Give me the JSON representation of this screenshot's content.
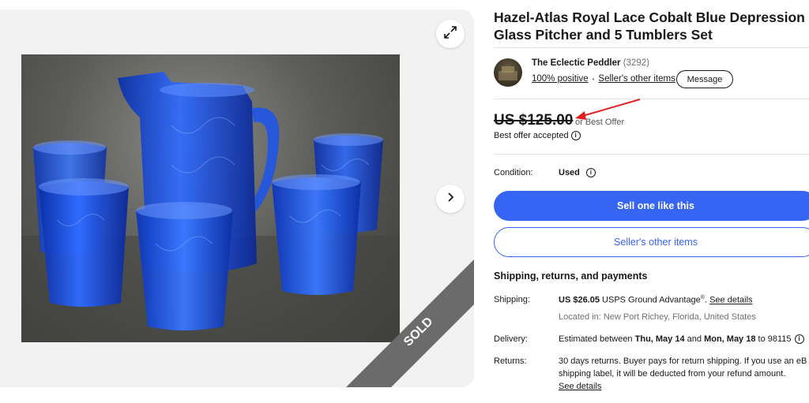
{
  "gallery": {
    "expand_icon": "expand-icon",
    "next_icon": "chevron-right-icon",
    "sold_ribbon": "SOLD"
  },
  "listing": {
    "title": "Hazel-Atlas Royal Lace Cobalt Blue Depression Glass Pitcher and 5 Tumblers Set"
  },
  "seller": {
    "name": "The Eclectic Peddler",
    "count": "(3292)",
    "positive": "100% positive",
    "other_items": "Seller's other items",
    "message_label": "Message"
  },
  "price": {
    "amount": "US $125.00",
    "or_best_offer": "or Best Offer",
    "best_offer_accepted": "Best offer accepted"
  },
  "condition": {
    "label": "Condition:",
    "value": "Used"
  },
  "actions": {
    "sell_one_like_this": "Sell one like this",
    "sellers_other_items": "Seller's other items"
  },
  "shipping": {
    "heading": "Shipping, returns, and payments",
    "shipping_label": "Shipping:",
    "shipping_price": "US $26.05",
    "shipping_service": "USPS Ground Advantage",
    "shipping_reg": "®",
    "shipping_period": ".",
    "see_details": "See details",
    "located_in": "Located in: New Port Richey, Florida, United States",
    "delivery_label": "Delivery:",
    "delivery_prefix": "Estimated between ",
    "delivery_start": "Thu, May 14",
    "delivery_and": " and ",
    "delivery_end": "Mon, May 18",
    "delivery_to": " to 98115",
    "returns_label": "Returns:",
    "returns_line1": "30 days returns. Buyer pays for return shipping. If you use an eB",
    "returns_line2": "shipping label, it will be deducted from your refund amount.",
    "returns_see_details": "See details"
  },
  "colors": {
    "primary_blue": "#3665f3",
    "annotation_red": "#e02020",
    "text": "#191919",
    "muted": "#707070"
  }
}
